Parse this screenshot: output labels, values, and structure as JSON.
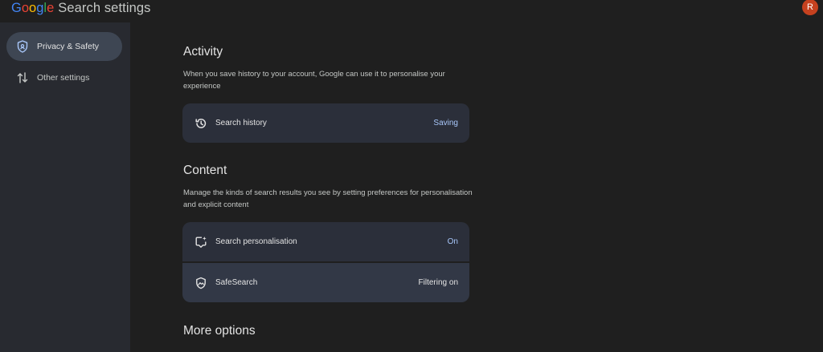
{
  "header": {
    "logo_letters": [
      {
        "char": "G",
        "color": "#4285F4"
      },
      {
        "char": "o",
        "color": "#EA4335"
      },
      {
        "char": "o",
        "color": "#FBBC05"
      },
      {
        "char": "g",
        "color": "#4285F4"
      },
      {
        "char": "l",
        "color": "#34A853"
      },
      {
        "char": "e",
        "color": "#EA4335"
      }
    ],
    "title": "Search settings",
    "avatar_initial": "R"
  },
  "sidebar": {
    "items": [
      {
        "label": "Privacy & Safety",
        "icon": "shield-icon",
        "active": true
      },
      {
        "label": "Other settings",
        "icon": "sort-arrows-icon",
        "active": false
      }
    ]
  },
  "activity": {
    "title": "Activity",
    "description": "When you save history to your account, Google can use it to personalise your experience",
    "cards": [
      {
        "label": "Search history",
        "value": "Saving",
        "icon": "history-icon"
      }
    ]
  },
  "content": {
    "title": "Content",
    "description": "Manage the kinds of search results you see by setting preferences for personalisation and explicit content",
    "cards": [
      {
        "label": "Search personalisation",
        "value": "On",
        "icon": "personalisation-icon"
      },
      {
        "label": "SafeSearch",
        "value": "Filtering on",
        "icon": "safesearch-icon"
      }
    ]
  },
  "more_options": {
    "title": "More options"
  },
  "colors": {
    "accent_value": "#a8c7fa",
    "neutral_value": "#e3e3e3",
    "avatar_bg": "#c5411f"
  }
}
